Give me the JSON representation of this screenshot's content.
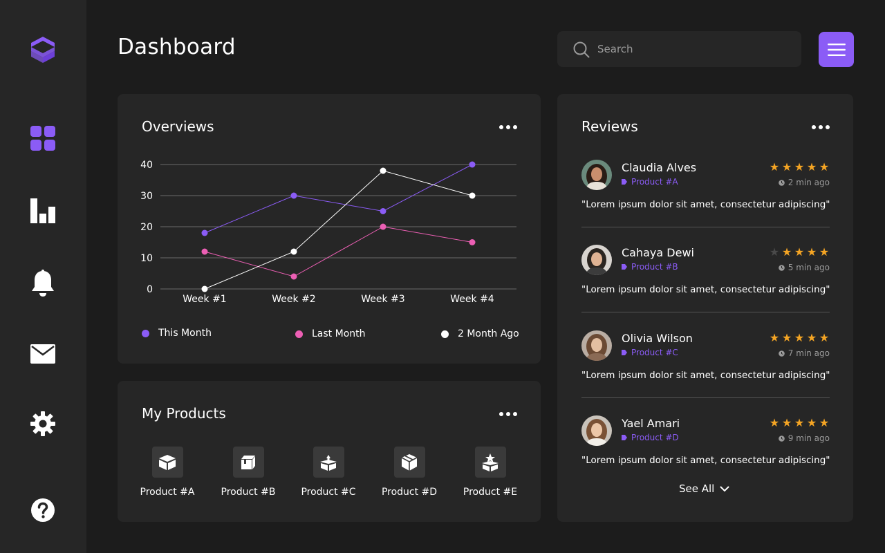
{
  "header": {
    "title": "Dashboard",
    "search_placeholder": "Search"
  },
  "sidebar": {
    "items": [
      {
        "icon": "logo-icon"
      },
      {
        "icon": "grid-dashboard-icon",
        "active": true
      },
      {
        "icon": "bar-chart-icon"
      },
      {
        "icon": "bell-icon"
      },
      {
        "icon": "mail-icon"
      },
      {
        "icon": "gear-icon"
      },
      {
        "icon": "help-icon"
      }
    ]
  },
  "colors": {
    "accent": "#8b5cf6",
    "this_month": "#8b5cf6",
    "last_month": "#ec5fb4",
    "two_month_ago": "#ffffff",
    "star": "#f5a524"
  },
  "overview": {
    "title": "Overviews",
    "legend": {
      "this_month": "This Month",
      "last_month": "Last Month",
      "two_month_ago": "2 Month Ago"
    }
  },
  "chart_data": {
    "type": "line",
    "title": "Overviews",
    "categories": [
      "Week #1",
      "Week #2",
      "Week #3",
      "Week #4"
    ],
    "y_ticks": [
      "0",
      "10",
      "20",
      "30",
      "40"
    ],
    "ylim": [
      0,
      40
    ],
    "grid": true,
    "legend_position": "bottom",
    "series": [
      {
        "name": "This Month",
        "color": "#8b5cf6",
        "values": [
          18,
          30,
          25,
          40
        ]
      },
      {
        "name": "Last Month",
        "color": "#ec5fb4",
        "values": [
          12,
          4,
          20,
          15
        ]
      },
      {
        "name": "2 Month Ago",
        "color": "#ffffff",
        "values": [
          0,
          12,
          38,
          30
        ]
      }
    ]
  },
  "products": {
    "title": "My Products",
    "items": [
      {
        "label": "Product #A"
      },
      {
        "label": "Product #B"
      },
      {
        "label": "Product #C"
      },
      {
        "label": "Product #D"
      },
      {
        "label": "Product #E"
      }
    ]
  },
  "reviews": {
    "title": "Reviews",
    "see_all": "See All",
    "items": [
      {
        "name": "Claudia Alves",
        "product": "Product #A",
        "time": "2 min ago",
        "rating": 5,
        "text": "\"Lorem ipsum dolor sit amet, consectetur adipiscing\""
      },
      {
        "name": "Cahaya Dewi",
        "product": "Product #B",
        "time": "5 min ago",
        "rating": 4,
        "text": "\"Lorem ipsum dolor sit amet, consectetur adipiscing\""
      },
      {
        "name": "Olivia Wilson",
        "product": "Product #C",
        "time": "7 min ago",
        "rating": 5,
        "text": "\"Lorem ipsum dolor sit amet, consectetur adipiscing\""
      },
      {
        "name": "Yael Amari",
        "product": "Product #D",
        "time": "9 min ago",
        "rating": 5,
        "text": "\"Lorem ipsum dolor sit amet, consectetur adipiscing\""
      }
    ]
  }
}
